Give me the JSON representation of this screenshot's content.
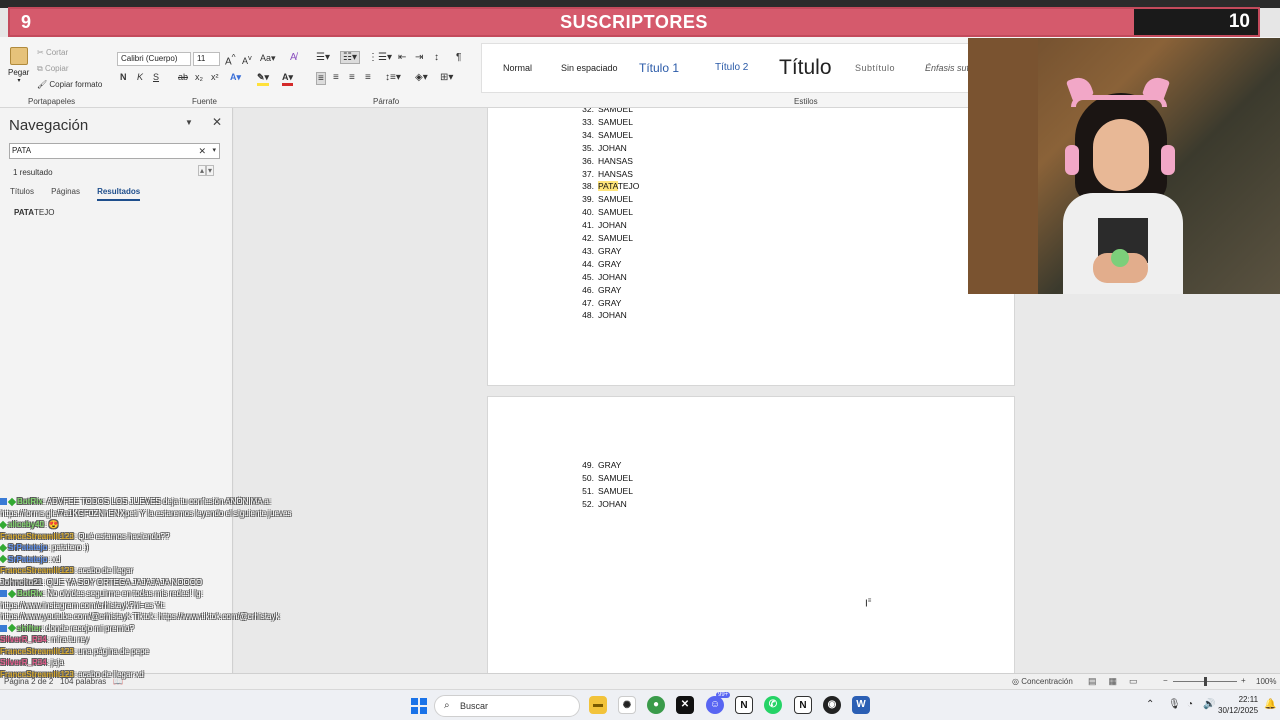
{
  "overlay": {
    "left_number": "9",
    "title": "SUSCRIPTORES",
    "right_number": "10"
  },
  "ribbon": {
    "clipboard": {
      "paste": "Pegar",
      "cut": "Cortar",
      "copy": "Copiar",
      "format_painter": "Copiar formato",
      "group": "Portapapeles"
    },
    "font": {
      "family": "Calibri (Cuerpo)",
      "size": "11",
      "group": "Fuente",
      "bold": "N",
      "italic": "K",
      "underline": "S"
    },
    "paragraph": {
      "group": "Párrafo"
    },
    "styles": {
      "group": "Estilos",
      "items": [
        "Normal",
        "Sin espaciado",
        "Título 1",
        "Título 2",
        "Título",
        "Subtítulo",
        "Énfasis sutil"
      ]
    }
  },
  "nav": {
    "title": "Navegación",
    "search_value": "PATA",
    "result_count": "1 resultado",
    "tabs": [
      "Títulos",
      "Páginas",
      "Resultados"
    ],
    "active_tab": "Resultados",
    "result_match": "PATA",
    "result_rest": "TEJO"
  },
  "document": {
    "page1_items": [
      {
        "n": "32.",
        "name": "SAMUEL"
      },
      {
        "n": "33.",
        "name": "SAMUEL"
      },
      {
        "n": "34.",
        "name": "SAMUEL"
      },
      {
        "n": "35.",
        "name": "JOHAN"
      },
      {
        "n": "36.",
        "name": "HANSAS"
      },
      {
        "n": "37.",
        "name": "HANSAS"
      },
      {
        "n": "38.",
        "name": "PATATEJO",
        "hl": "PATA",
        "rest": "TEJO"
      },
      {
        "n": "39.",
        "name": "SAMUEL"
      },
      {
        "n": "40.",
        "name": "SAMUEL"
      },
      {
        "n": "41.",
        "name": "JOHAN"
      },
      {
        "n": "42.",
        "name": "SAMUEL"
      },
      {
        "n": "43.",
        "name": "GRAY"
      },
      {
        "n": "44.",
        "name": "GRAY"
      },
      {
        "n": "45.",
        "name": "JOHAN"
      },
      {
        "n": "46.",
        "name": "GRAY"
      },
      {
        "n": "47.",
        "name": "GRAY"
      },
      {
        "n": "48.",
        "name": "JOHAN"
      }
    ],
    "page2_items": [
      {
        "n": "49.",
        "name": "GRAY"
      },
      {
        "n": "50.",
        "name": "SAMUEL"
      },
      {
        "n": "51.",
        "name": "SAMUEL"
      },
      {
        "n": "52.",
        "name": "JOHAN"
      }
    ]
  },
  "chat": [
    {
      "badges": [
        "blue",
        "mod"
      ],
      "user": "BotRix",
      "user_color": "#7fd36b",
      "text": ": ADVFEE TODOS LOS JUEVES deja tu confesión ANÓNIMA a:"
    },
    {
      "badges": [],
      "user": "",
      "user_color": "#ffffff",
      "text": "https://forms.gle/7a1KGF0ZNhENXpeti Y la estaremos leyendo el siguiente jueves"
    },
    {
      "badges": [
        "mod"
      ],
      "user": "aliceby40",
      "user_color": "#7fd36b",
      "text": ": 😍"
    },
    {
      "badges": [],
      "user": "FranceStreamlit123",
      "user_color": "#d4a72c",
      "text": ": Qué estamos haciendo??"
    },
    {
      "badges": [
        "mod"
      ],
      "user": "SrPatatejo",
      "user_color": "#5b8de8",
      "text": ": patatero :)"
    },
    {
      "badges": [
        "mod"
      ],
      "user": "SrPatatejo",
      "user_color": "#5b8de8",
      "text": ": xd"
    },
    {
      "badges": [],
      "user": "FranceStreamlit123",
      "user_color": "#d4a72c",
      "text": ": acabo de llegar"
    },
    {
      "badges": [],
      "user": "Johncito21",
      "user_color": "#cccccc",
      "text": ": QUE YA SOY ORTEGA JAJAJAJA NOOOO"
    },
    {
      "badges": [
        "blue",
        "mod"
      ],
      "user": "BotRix",
      "user_color": "#7fd36b",
      "text": ": No olvides seguirme en todas mis redes! Ig:"
    },
    {
      "badges": [],
      "user": "",
      "user_color": "#ffffff",
      "text": "https://www.instagram.com/crhistayk?hl=es Yt:"
    },
    {
      "badges": [],
      "user": "",
      "user_color": "#ffffff",
      "text": "https://www.youtube.com/@crhistayk Tiktok: https://www.tiktok.com/@crhistayk"
    },
    {
      "badges": [
        "blue",
        "mod"
      ],
      "user": "shifter",
      "user_color": "#7fd36b",
      "text": ": donde recojo mi premio?"
    },
    {
      "badges": [],
      "user": "SilverR_R34",
      "user_color": "#e05a8a",
      "text": ": mira tu rey"
    },
    {
      "badges": [],
      "user": "FranceStreamlit123",
      "user_color": "#d4a72c",
      "text": ": una página de pepe"
    },
    {
      "badges": [],
      "user": "SilverR_R34",
      "user_color": "#e05a8a",
      "text": ": jaja"
    },
    {
      "badges": [],
      "user": "FranceStreamlit123",
      "user_color": "#d4a72c",
      "text": ": acabo de llegar xd"
    }
  ],
  "status": {
    "page_info": "Página 2 de 2",
    "words": "104 palabras",
    "focus": "Concentración",
    "zoom": "100%",
    "zoom_fraction": 0.5
  },
  "taskbar": {
    "search_label": "Buscar",
    "time": "22:11",
    "date": "30/12/2025",
    "badge": "99+"
  }
}
